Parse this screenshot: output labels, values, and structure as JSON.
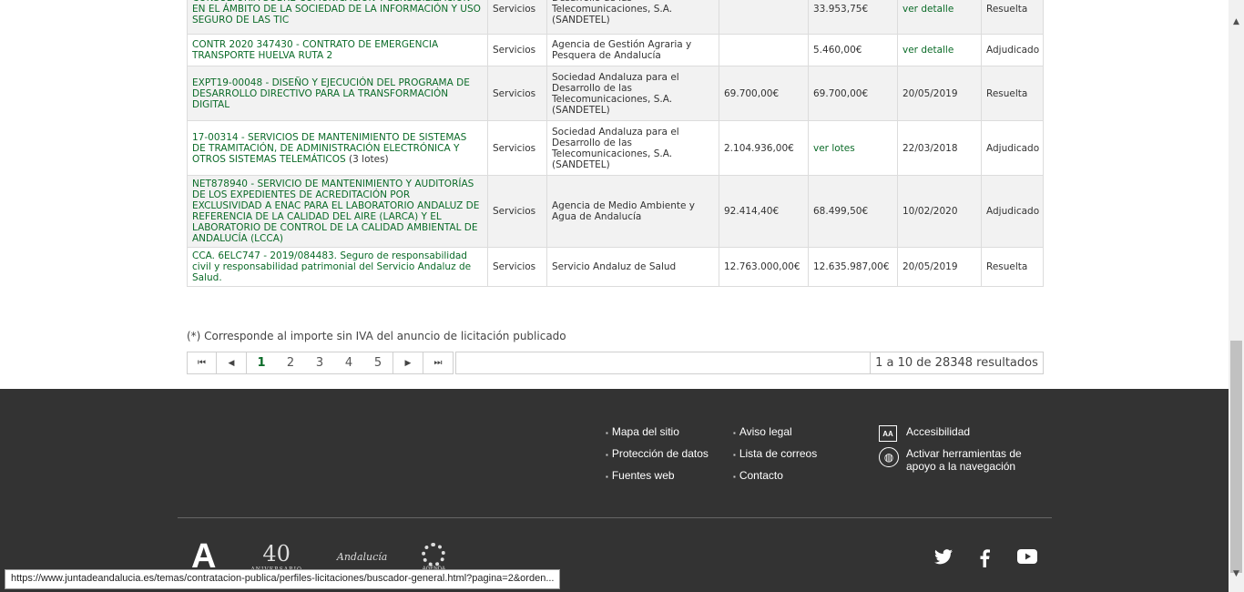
{
  "rows": [
    {
      "objeto": "CONSULTORÍA SOBRE COMUNICACIÓN Y SENSIBILIZACIÓN EN EL ÁMBITO DE LA SOCIEDAD DE LA INFORMACIÓN Y USO SEGURO DE LAS TIC",
      "tipo": "Servicios",
      "organo": "Desarrollo de las Telecomunicaciones, S.A. (SANDETEL)",
      "importe": "",
      "adjudicacion": "33.953,75€",
      "fecha": "ver detalle",
      "estado": "Resuelta"
    },
    {
      "objeto": "CONTR 2020 347430 - CONTRATO DE EMERGENCIA TRANSPORTE HUELVA RUTA 2",
      "tipo": "Servicios",
      "organo": "Agencia de Gestión Agraria y Pesquera de Andalucía",
      "importe": "",
      "adjudicacion": "5.460,00€",
      "fecha": "ver detalle",
      "estado": "Adjudicado"
    },
    {
      "objeto": "EXPT19-00048 - DISEÑO Y EJECUCIÓN DEL PROGRAMA DE DESARROLLO DIRECTIVO PARA LA TRANSFORMACIÓN DIGITAL",
      "tipo": "Servicios",
      "organo": "Sociedad Andaluza para el Desarrollo de las Telecomunicaciones, S.A. (SANDETEL)",
      "importe": "69.700,00€",
      "adjudicacion": "69.700,00€",
      "fecha": "20/05/2019",
      "estado": "Resuelta"
    },
    {
      "objeto": "17-00314 - SERVICIOS DE MANTENIMIENTO DE SISTEMAS DE TRAMITACIÓN, DE ADMINISTRACIÓN ELECTRÓNICA Y OTROS SISTEMAS TELEMÁTICOS",
      "suffix": "(3 lotes)",
      "tipo": "Servicios",
      "organo": "Sociedad Andaluza para el Desarrollo de las Telecomunicaciones, S.A. (SANDETEL)",
      "importe": "2.104.936,00€",
      "adjudicacion": "ver lotes",
      "fecha": "22/03/2018",
      "estado": "Adjudicado"
    },
    {
      "objeto": "NET878940 - SERVICIO DE MANTENIMIENTO Y AUDITORÍAS DE LOS EXPEDIENTES DE ACREDITACIÓN POR EXCLUSIVIDAD A ENAC PARA EL LABORATORIO ANDALUZ DE REFERENCIA DE LA CALIDAD DEL AIRE (LARCA) Y EL LABORATORIO DE CONTROL DE LA CALIDAD AMBIENTAL DE ANDALUCÍA (LCCA)",
      "tipo": "Servicios",
      "organo": "Agencia de Medio Ambiente y Agua de Andalucía",
      "importe": "92.414,40€",
      "adjudicacion": "68.499,50€",
      "fecha": "10/02/2020",
      "estado": "Adjudicado"
    },
    {
      "objeto": "CCA. 6ELC747 - 2019/084483. Seguro de responsabilidad civil y responsabilidad patrimonial del Servicio Andaluz de Salud.",
      "tipo": "Servicios",
      "organo": "Servicio Andaluz de Salud",
      "importe": "12.763.000,00€",
      "adjudicacion": "12.635.987,00€",
      "fecha": "20/05/2019",
      "estado": "Resuelta"
    }
  ],
  "note": "(*) Corresponde al importe sin IVA del anuncio de licitación publicado",
  "pager": {
    "first": "⏮",
    "prev": "◀",
    "pages": [
      "1",
      "2",
      "3",
      "4",
      "5"
    ],
    "next": "▶",
    "last": "⏭",
    "summary": "1 a 10 de 28348 resultados"
  },
  "footer": {
    "links": {
      "mapa": "Mapa del sitio",
      "proteccion": "Protección de datos",
      "fuentes": "Fuentes web",
      "aviso": "Aviso legal",
      "lista": "Lista de correos",
      "contacto": "Contacto"
    },
    "accesibilidad": "Accesibilidad",
    "herramientas": "Activar herramientas de apoyo a la navegación",
    "logos": {
      "a": "A",
      "anniv_num": "40",
      "anniv_txt": "ANIVERSARIO",
      "andalucia": "Andalucía",
      "agenda": "AGENDA"
    }
  },
  "social": [
    "twitter-icon",
    "facebook-icon",
    "youtube-icon"
  ],
  "status_url": "https://www.juntadeandalucia.es/temas/contratacion-publica/perfiles-licitaciones/buscador-general.html?pagina=2&orden..."
}
